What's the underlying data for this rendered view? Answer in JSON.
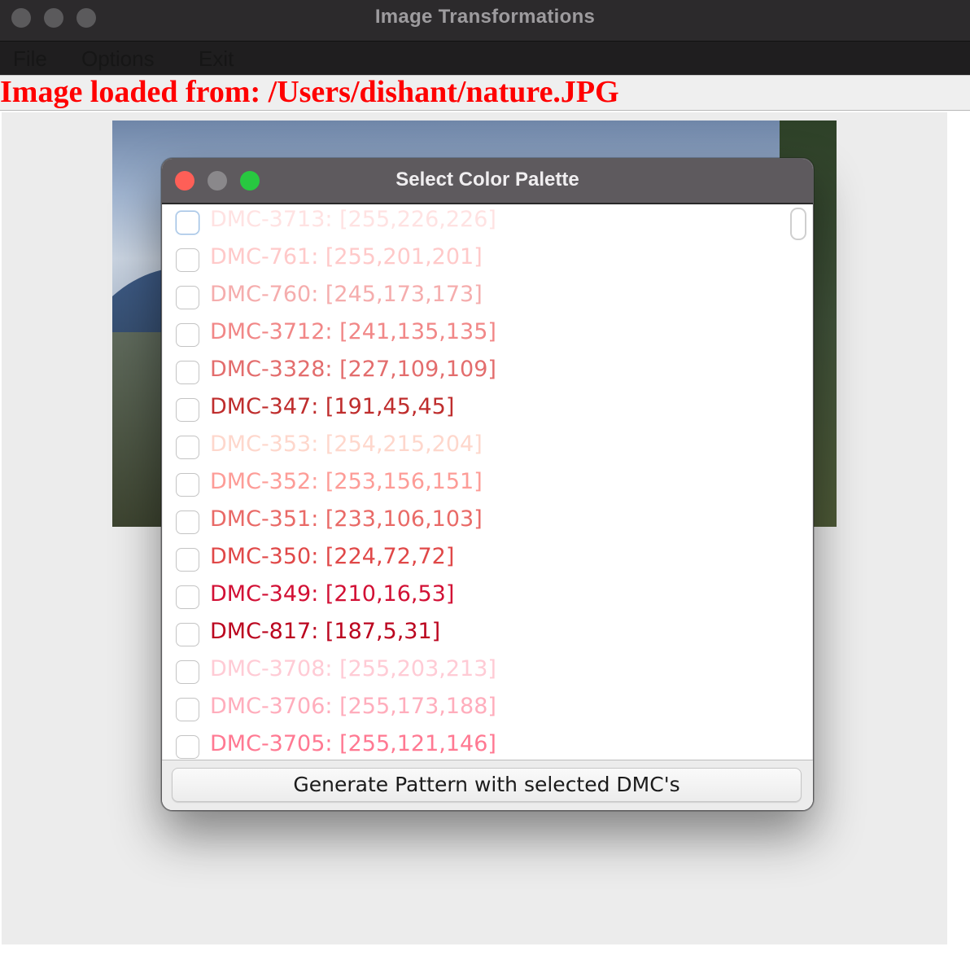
{
  "window": {
    "title": "Image Transformations"
  },
  "menubar": {
    "items": [
      "File",
      "Options",
      "Exit"
    ]
  },
  "status": {
    "message": "Image loaded from: /Users/dishant/nature.JPG"
  },
  "dialog": {
    "title": "Select Color Palette",
    "button_label": "Generate Pattern with selected DMC's",
    "items": [
      {
        "label": "DMC-3713: [255,226,226]",
        "color": "#ffe2e2"
      },
      {
        "label": "DMC-761: [255,201,201]",
        "color": "#ffc9c9"
      },
      {
        "label": "DMC-760: [245,173,173]",
        "color": "#f5adad"
      },
      {
        "label": "DMC-3712: [241,135,135]",
        "color": "#f18787"
      },
      {
        "label": "DMC-3328: [227,109,109]",
        "color": "#e36d6d"
      },
      {
        "label": "DMC-347: [191,45,45]",
        "color": "#bf2d2d"
      },
      {
        "label": "DMC-353: [254,215,204]",
        "color": "#fed7cc"
      },
      {
        "label": "DMC-352: [253,156,151]",
        "color": "#fd9c97"
      },
      {
        "label": "DMC-351: [233,106,103]",
        "color": "#e96a67"
      },
      {
        "label": "DMC-350: [224,72,72]",
        "color": "#e04848"
      },
      {
        "label": "DMC-349: [210,16,53]",
        "color": "#d21035"
      },
      {
        "label": "DMC-817: [187,5,31]",
        "color": "#bb051f"
      },
      {
        "label": "DMC-3708: [255,203,213]",
        "color": "#ffcbd5"
      },
      {
        "label": "DMC-3706: [255,173,188]",
        "color": "#ffadbc"
      },
      {
        "label": "DMC-3705: [255,121,146]",
        "color": "#ff7992"
      }
    ]
  }
}
